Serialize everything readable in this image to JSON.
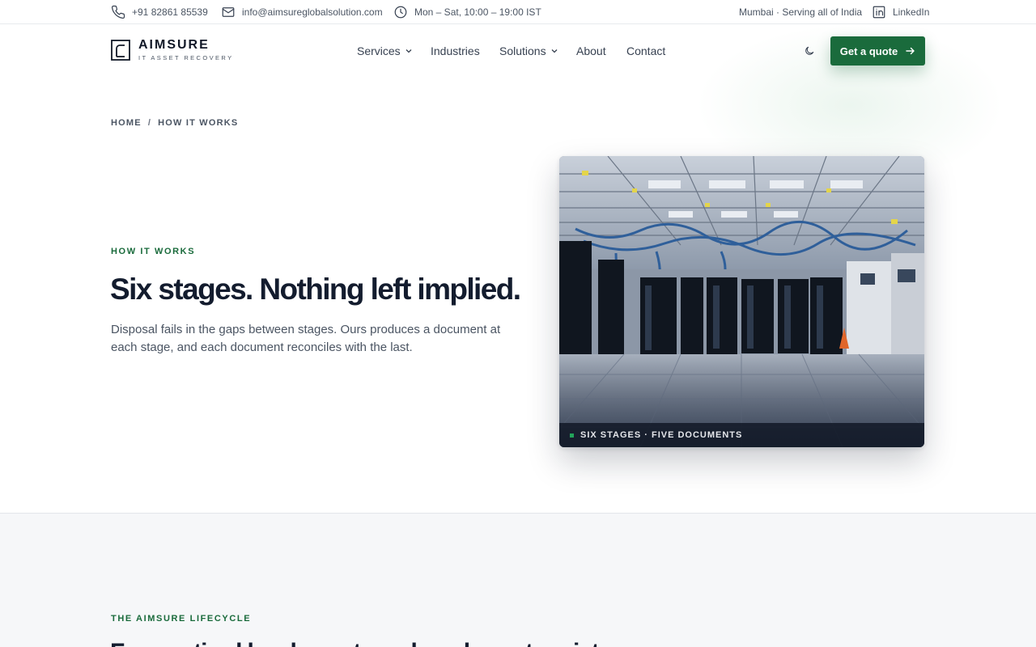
{
  "topbar": {
    "phone": "+91 82861 85539",
    "email": "info@aimsureglobalsolution.com",
    "hours": "Mon – Sat, 10:00 – 19:00 IST",
    "location": "Mumbai · Serving all of India",
    "social": "LinkedIn"
  },
  "brand": {
    "name": "AIMSURE",
    "tagline": "IT ASSET RECOVERY"
  },
  "nav": {
    "items": [
      {
        "label": "Services",
        "dropdown": true
      },
      {
        "label": "Industries",
        "dropdown": false
      },
      {
        "label": "Solutions",
        "dropdown": true
      },
      {
        "label": "About",
        "dropdown": false
      },
      {
        "label": "Contact",
        "dropdown": false
      }
    ],
    "cta_label": "Get a quote"
  },
  "breadcrumb": {
    "home": "HOME",
    "separator": "/",
    "current": "HOW IT WORKS"
  },
  "hero": {
    "eyebrow": "HOW IT WORKS",
    "title": "Six stages. Nothing left implied.",
    "lead": "Disposal fails in the gaps between stages. Ours produces a document at each stage, and each document reconciles with the last.",
    "image_caption": "SIX STAGES · FIVE DOCUMENTS"
  },
  "lifecycle": {
    "eyebrow": "THE AIMSURE LIFECYCLE",
    "title": "From retired hardware to a closed asset register"
  },
  "colors": {
    "brand_green": "#1a6b3c",
    "heading": "#131c2e",
    "body_text": "#4b5563"
  },
  "icons": {
    "phone": "phone-icon",
    "email": "mail-icon",
    "hours": "clock-icon",
    "social": "linkedin-icon",
    "theme": "moon-icon",
    "cta": "arrow-right-icon"
  }
}
